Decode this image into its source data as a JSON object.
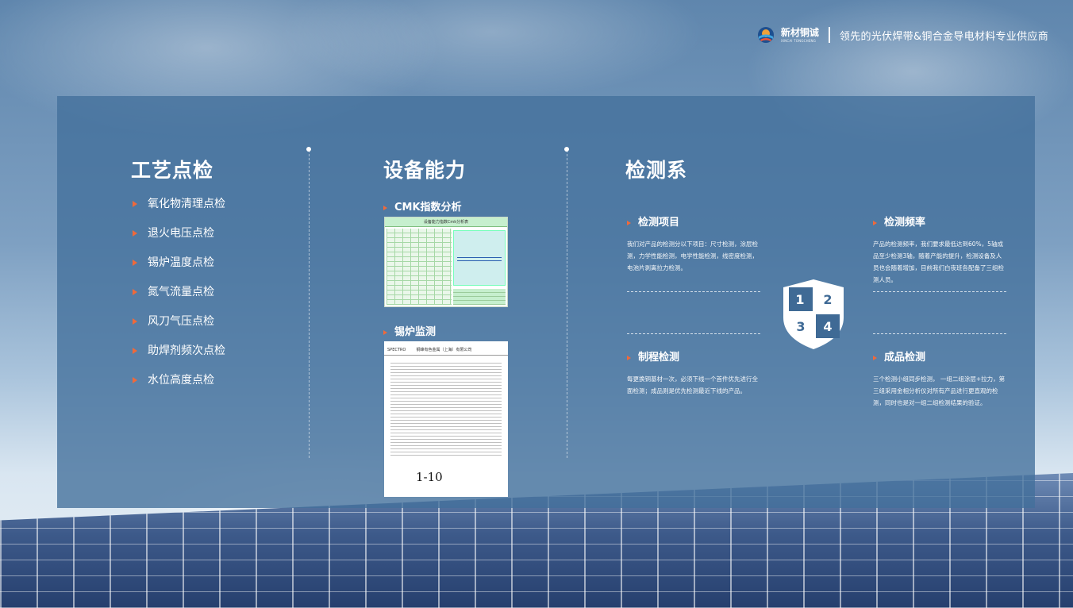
{
  "header": {
    "brand_name": "新材铜诚",
    "brand_sub": "XINCAI TONGCHENG",
    "slogan": "领先的光伏焊带&铜合金导电材料专业供应商"
  },
  "process": {
    "title": "工艺点检",
    "items": [
      "氧化物清理点检",
      "退火电压点检",
      "锡炉温度点检",
      "氮气流量点检",
      "风刀气压点检",
      "助焊剂频次点检",
      "水位高度点检"
    ]
  },
  "equipment": {
    "title": "设备能力",
    "cmk_label": "CMK指数分析",
    "cmk_sheet_title": "设备能力指数Cmk分析表",
    "boiler_label": "锡炉监测",
    "boiler_company": "SPECTRO 　　 钢峰有色金属（上海）有限公司",
    "boiler_sign": "1-10"
  },
  "detection": {
    "title": "检测系",
    "items_block": {
      "label": "检测项目",
      "text": "我们对产品的检测分以下项目：尺寸检测，涂层检测，力学性能检测，电学性能检测，线密度检测，电池片剥离拉力检测。"
    },
    "frequency_block": {
      "label": "检测频率",
      "text": "产品的检测频率，我们要求最低达到60%，5轴成品至少检测3轴，随着产能的提升，检测设备及人员也会随着增加，目前我们白夜班各配备了三组检测人员。"
    },
    "process_block": {
      "label": "制程检测",
      "text": "每更换铜基材一次，必须下线一个首件优先进行全面检测；成品则是优先检测最近下线的产品。"
    },
    "final_block": {
      "label": "成品检测",
      "text": "三个检测小组同步检测， 一组二组涂层+拉力，第三组采用金相分析仪对所有产品进行更直观的检测，同时也是对一组二组检测结果的验证。"
    },
    "shield_numbers": [
      "1",
      "2",
      "3",
      "4"
    ]
  },
  "colors": {
    "bullet": "#f0693a",
    "panel": "#426f9b",
    "shield": "#ffffff",
    "shield_text": "#3f6a95"
  }
}
